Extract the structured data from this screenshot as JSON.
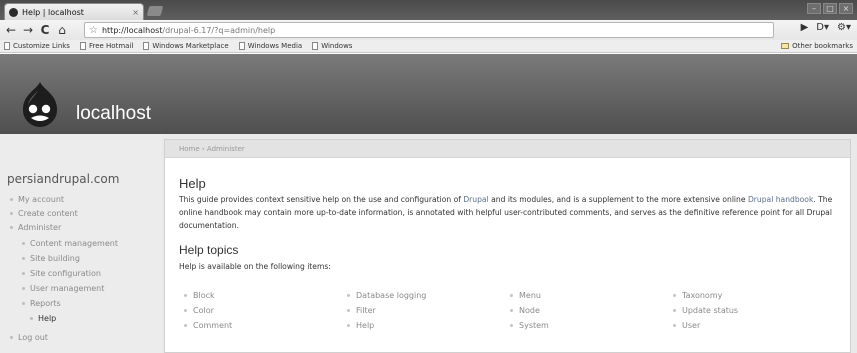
{
  "browser": {
    "tab_title": "Help | localhost",
    "tab_close": "×",
    "url_host": "http://localhost",
    "url_path": "/drupal-6.17/?q=admin/help",
    "nav": {
      "back": "←",
      "forward": "→",
      "reload": "C",
      "home": "⌂",
      "star": "☆"
    },
    "window_controls": [
      "–",
      "□",
      "×"
    ],
    "toolbar_icons": [
      "▶",
      "D▾",
      "⚙▾"
    ],
    "bookmarks": [
      "Customize Links",
      "Free Hotmail",
      "Windows Marketplace",
      "Windows Media",
      "Windows"
    ],
    "other_bookmarks": "Other bookmarks"
  },
  "site": {
    "name": "localhost"
  },
  "sidebar": {
    "title": "persiandrupal.com",
    "items": [
      {
        "label": "My account",
        "level": 0
      },
      {
        "label": "Create content",
        "level": 0
      },
      {
        "label": "Administer",
        "level": 0
      },
      {
        "label": "Content management",
        "level": 1
      },
      {
        "label": "Site building",
        "level": 1
      },
      {
        "label": "Site configuration",
        "level": 1
      },
      {
        "label": "User management",
        "level": 1
      },
      {
        "label": "Reports",
        "level": 1
      },
      {
        "label": "Help",
        "level": 1,
        "active": true
      },
      {
        "label": "Log out",
        "level": 0
      }
    ]
  },
  "content": {
    "breadcrumb": "Home › Administer",
    "title": "Help",
    "intro_pre": "This guide provides context sensitive help on the use and configuration of ",
    "intro_link1": "Drupal",
    "intro_mid1": " and its modules, and is a supplement to the more extensive online ",
    "intro_link2": "Drupal handbook",
    "intro_post": ". The online handbook may contain more up-to-date information, is annotated with helpful user-contributed comments, and serves as the definitive reference point for all Drupal documentation.",
    "topics_title": "Help topics",
    "topics_intro": "Help is available on the following items:",
    "topics": [
      [
        "Block",
        "Color",
        "Comment"
      ],
      [
        "Database logging",
        "Filter",
        "Help"
      ],
      [
        "Menu",
        "Node",
        "System"
      ],
      [
        "Taxonomy",
        "Update status",
        "User"
      ]
    ]
  }
}
